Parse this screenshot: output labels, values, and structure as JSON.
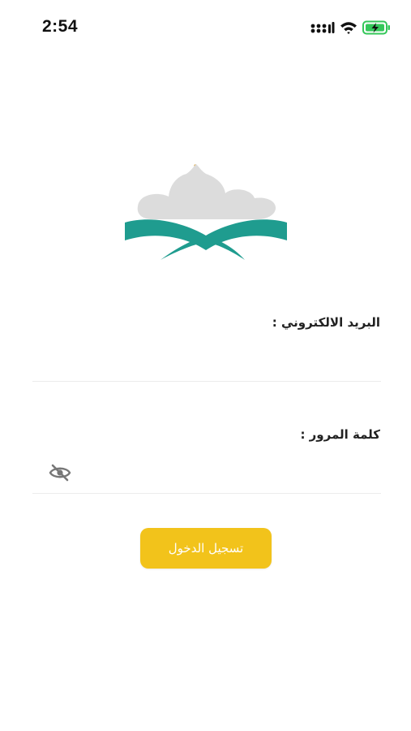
{
  "status_bar": {
    "time": "2:54",
    "icons": [
      "cellular-signal-icon",
      "wifi-icon",
      "battery-charging-icon"
    ]
  },
  "logo": {
    "icon": "mosque-quran-logo",
    "colors": {
      "dome": "#dcdcdc",
      "book": "#1f9c8f",
      "crescent": "#d9a441"
    }
  },
  "form": {
    "email_label": "البريد الالكتروني :",
    "email_value": "",
    "password_label": "كلمة المرور :",
    "password_value": "",
    "password_toggle_icon": "eye-slash-icon",
    "login_button": "تسجيل الدخول"
  },
  "colors": {
    "accent": "#f2c31b",
    "divider": "#ececec",
    "charging": "#34c759"
  }
}
